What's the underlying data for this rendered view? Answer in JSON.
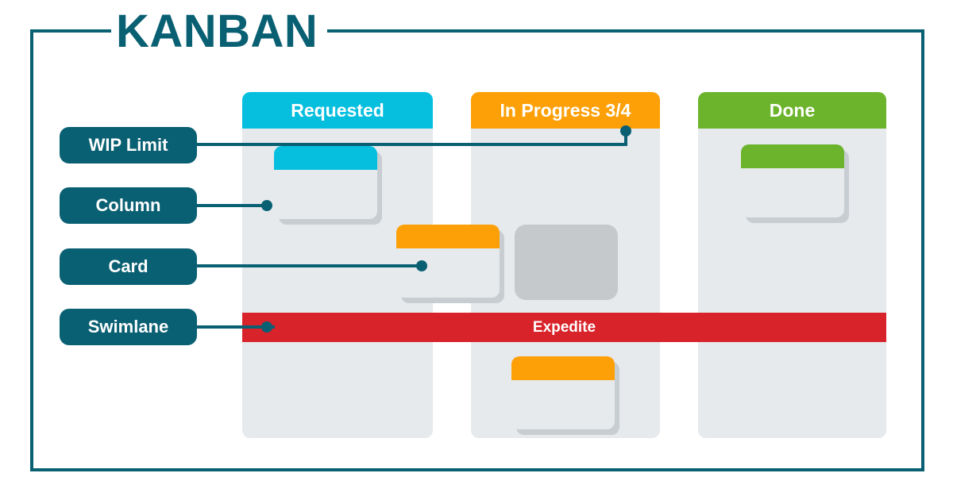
{
  "board": {
    "title": "KANBAN",
    "accent_color": "#0a6073",
    "canvas_background": "#ffffff"
  },
  "callouts": [
    {
      "id": "wip-limit",
      "label": "WIP Limit",
      "target": "in-progress-column-header-count"
    },
    {
      "id": "column",
      "label": "Column",
      "target": "requested-column"
    },
    {
      "id": "card",
      "label": "Card",
      "target": "card-mid"
    },
    {
      "id": "swimlane",
      "label": "Swimlane",
      "target": "expedite-swimlane"
    }
  ],
  "columns": [
    {
      "id": "requested",
      "title": "Requested",
      "header_color": "#06bfdf",
      "body_color": "#e6eaed",
      "wip_limit": null,
      "cards": [
        {
          "id": "card-req",
          "stripe_color": "#06bfdf",
          "body_color": "#e6eaed"
        }
      ]
    },
    {
      "id": "in-progress",
      "title": "In Progress 3/4",
      "header_color": "#fda008",
      "body_color": "#e6eaed",
      "wip_limit": "3/4",
      "cards": [
        {
          "id": "card-mid",
          "stripe_color": "#fda008",
          "body_color": "#e6eaed"
        },
        {
          "id": "card-ghost",
          "stripe_color": null,
          "body_color": "#c5c9cc"
        },
        {
          "id": "card-bottom",
          "stripe_color": "#fda008",
          "body_color": "#e6eaed"
        }
      ]
    },
    {
      "id": "done",
      "title": "Done",
      "header_color": "#6cb42c",
      "body_color": "#e6eaed",
      "wip_limit": null,
      "cards": [
        {
          "id": "card-done",
          "stripe_color": "#6cb42c",
          "body_color": "#e6eaed"
        }
      ]
    }
  ],
  "swimlane": {
    "id": "expedite",
    "label": "Expedite",
    "color": "#d8232a"
  }
}
